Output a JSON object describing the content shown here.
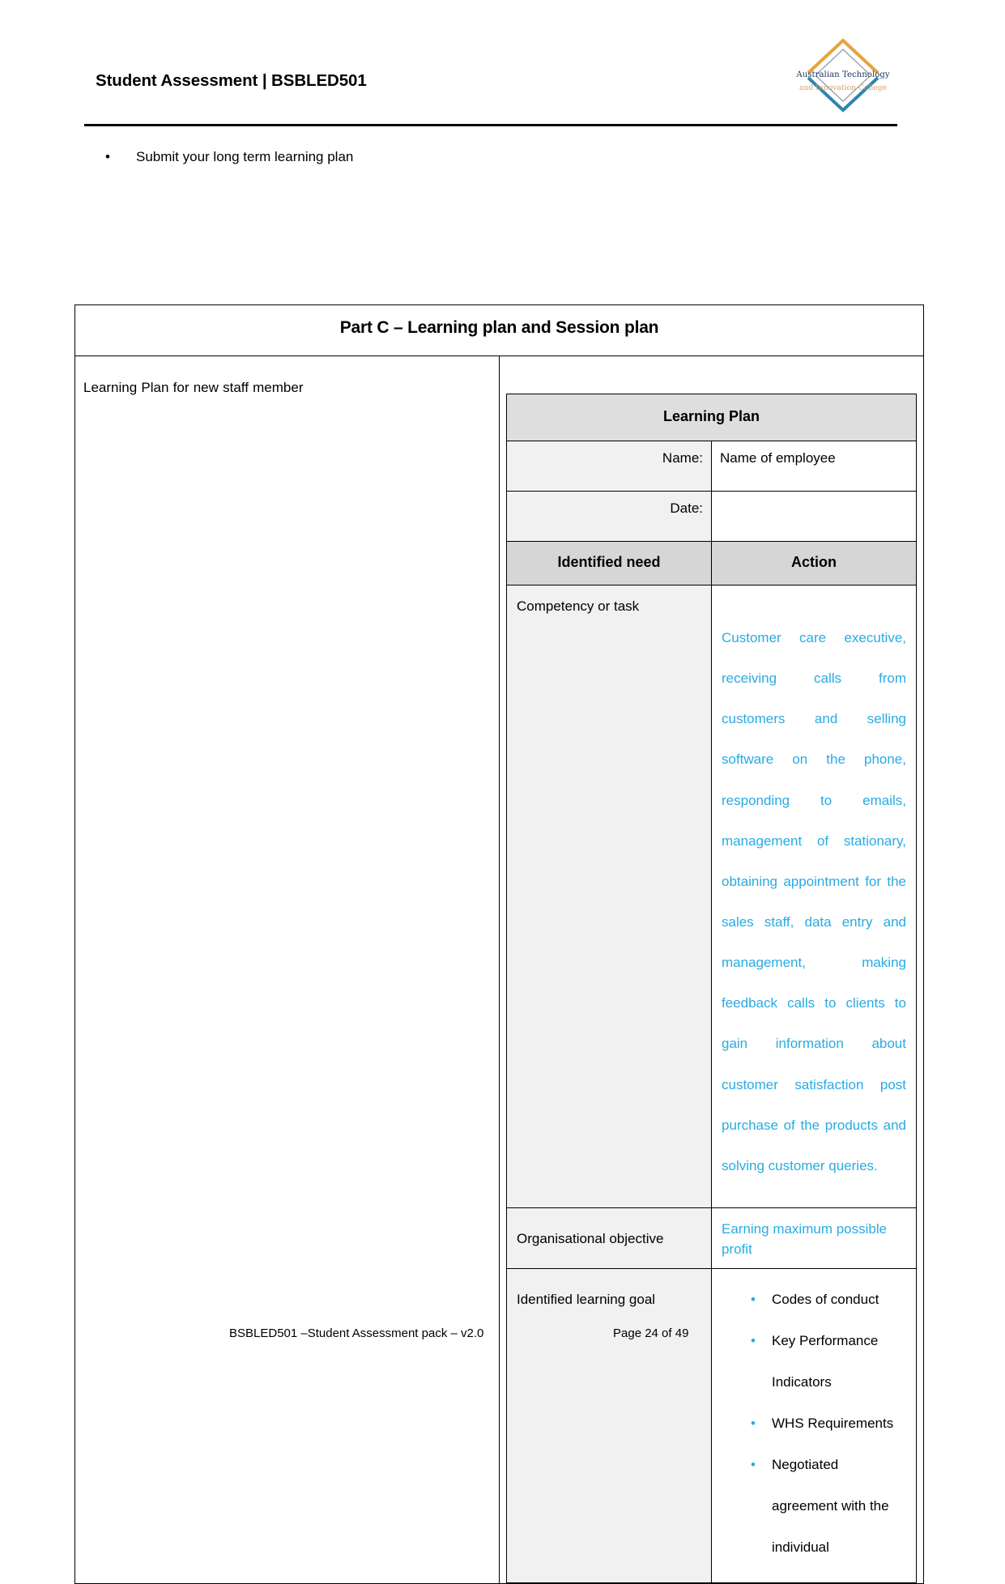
{
  "document": {
    "header_title": "Student Assessment | BSBLED501",
    "logo": {
      "name": "australian-technology-and-innovation-college-logo",
      "line1": "Australian Technology",
      "line2": "and Innovation College",
      "top_chevron_color": "#e8a33d",
      "bottom_chevron_color": "#2e86ab",
      "line1_color": "#1f3864",
      "line2_color": "#d9a36a"
    },
    "intro_bullet": {
      "marker": "•",
      "text": "Submit your long term learning plan"
    },
    "footer": {
      "left": "BSBLED501 –Student Assessment pack – v2.0",
      "right": "Page 24 of 49"
    }
  },
  "part_c": {
    "title": "Part C – Learning plan and Session plan",
    "left_label": "Learning Plan for new staff member"
  },
  "learning_plan": {
    "header": "Learning Plan",
    "fields": [
      {
        "label": "Name:",
        "value": "Name of employee"
      },
      {
        "label": "Date:",
        "value": ""
      }
    ],
    "column_headers": {
      "need": "Identified need",
      "action": "Action"
    },
    "rows": [
      {
        "need": "Competency or task",
        "action_paragraph": "Customer care executive, receiving calls from customers and selling software on the phone, responding to emails, management of stationary, obtaining appointment for the sales staff, data entry and management, making feedback calls to clients to gain information about customer satisfaction post purchase of the products and solving customer queries."
      },
      {
        "need": "Organisational objective",
        "action_line": "Earning maximum possible profit"
      },
      {
        "need": "Identified learning goal",
        "action_bullets": [
          "Codes of conduct",
          "Key Performance Indicators",
          "WHS Requirements",
          "Negotiated agreement with the individual"
        ],
        "bullet_marker": "•"
      }
    ]
  },
  "colors": {
    "accent_blue": "#29abe2",
    "header_gray": "#dedede",
    "label_gray": "#f1f1f1"
  }
}
